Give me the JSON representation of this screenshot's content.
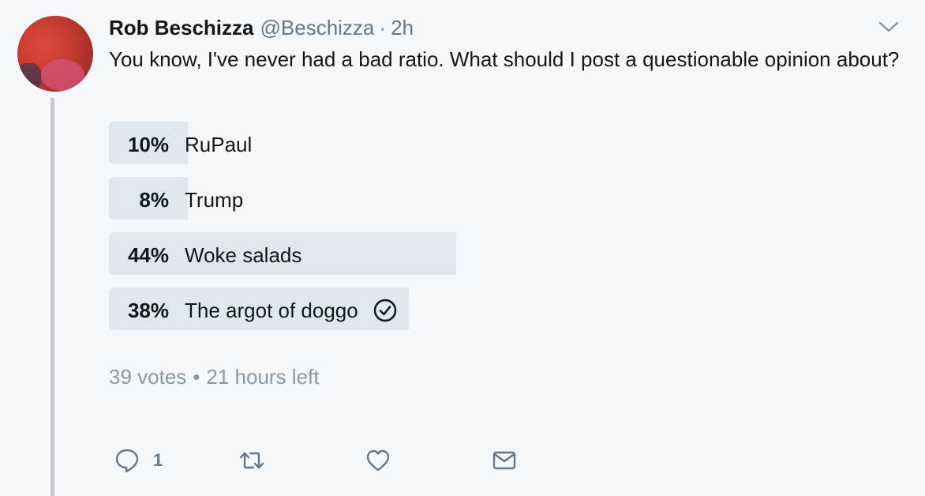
{
  "tweet": {
    "author_name": "Rob Beschizza",
    "handle": "@Beschizza",
    "separator": "·",
    "time": "2h",
    "text": "You know, I've never had a bad ratio. What should I post a questionable opinion about?"
  },
  "poll": {
    "choices": [
      {
        "percent_label": "10%",
        "percent": 10,
        "label": "RuPaul",
        "selected": false
      },
      {
        "percent_label": "8%",
        "percent": 8,
        "label": "Trump",
        "selected": false
      },
      {
        "percent_label": "44%",
        "percent": 44,
        "label": "Woke salads",
        "selected": false
      },
      {
        "percent_label": "38%",
        "percent": 38,
        "label": "The argot of doggo",
        "selected": true
      }
    ],
    "votes": "39 votes",
    "meta_separator": "•",
    "time_left": "21 hours left"
  },
  "actions": {
    "reply_count": "1"
  },
  "icons": {
    "menu": "chevron-down-icon",
    "reply": "reply-icon",
    "retweet": "retweet-icon",
    "like": "heart-icon",
    "dm": "envelope-icon",
    "selected": "check-circle-icon"
  },
  "colors": {
    "background": "#f5f8fa",
    "bar": "#e1e8ed",
    "muted": "#657786",
    "text": "#14171a"
  }
}
